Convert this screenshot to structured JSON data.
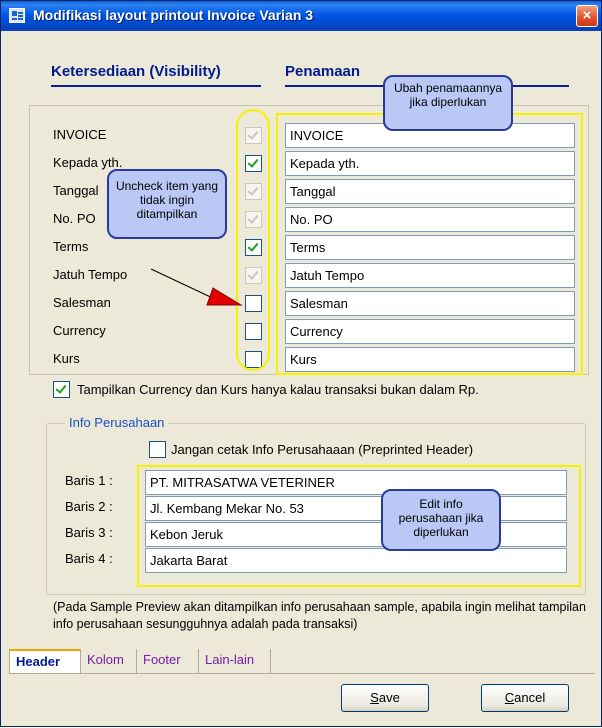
{
  "window": {
    "title": "Modifikasi layout printout Invoice Varian 3",
    "close_glyph": "×"
  },
  "headers": {
    "visibility": "Ketersediaan (Visibility)",
    "naming": "Penamaan"
  },
  "fields": [
    {
      "label": "INVOICE",
      "checked": true,
      "enabled": false,
      "value": "INVOICE"
    },
    {
      "label": "Kepada yth.",
      "checked": true,
      "enabled": true,
      "value": "Kepada yth."
    },
    {
      "label": "Tanggal",
      "checked": true,
      "enabled": false,
      "value": "Tanggal"
    },
    {
      "label": "No. PO",
      "checked": true,
      "enabled": false,
      "value": "No. PO"
    },
    {
      "label": "Terms",
      "checked": true,
      "enabled": true,
      "value": "Terms"
    },
    {
      "label": "Jatuh Tempo",
      "checked": true,
      "enabled": false,
      "value": "Jatuh Tempo"
    },
    {
      "label": "Salesman",
      "checked": false,
      "enabled": true,
      "value": "Salesman"
    },
    {
      "label": "Currency",
      "checked": false,
      "enabled": true,
      "value": "Currency"
    },
    {
      "label": "Kurs",
      "checked": false,
      "enabled": true,
      "value": "Kurs"
    }
  ],
  "callouts": {
    "rename": "Ubah penamaannya jika diperlukan",
    "uncheck": "Uncheck item yang tidak ingin ditampilkan",
    "edit_info": "Edit info perusahaan jika diperlukan"
  },
  "currency_option": {
    "checked": true,
    "label": "Tampilkan Currency dan Kurs hanya kalau transaksi bukan dalam Rp."
  },
  "info_perusahaan": {
    "legend": "Info Perusahaan",
    "no_print_checked": false,
    "no_print_label": "Jangan cetak Info Perusahaaan (Preprinted Header)",
    "rows": [
      {
        "label": "Baris 1 :",
        "value": "PT. MITRASATWA VETERINER"
      },
      {
        "label": "Baris 2 :",
        "value": "Jl. Kembang Mekar No. 53"
      },
      {
        "label": "Baris 3 :",
        "value": "Kebon Jeruk"
      },
      {
        "label": "Baris 4 :",
        "value": "Jakarta Barat"
      }
    ]
  },
  "note": "(Pada Sample Preview akan ditampilkan info perusahaan sample, apabila ingin melihat tampilan info perusahaan sesungguhnya adalah pada transaksi)",
  "tabs": [
    "Header",
    "Kolom",
    "Footer",
    "Lain-lain"
  ],
  "active_tab": "Header",
  "buttons": {
    "save_prefix": "S",
    "save_rest": "ave",
    "cancel_prefix": "C",
    "cancel_rest": "ancel"
  },
  "colors": {
    "title_bar": "#0058E6",
    "highlight": "#F7F100",
    "callout_fill": "#B9C8F5",
    "check_green": "#21A121"
  }
}
